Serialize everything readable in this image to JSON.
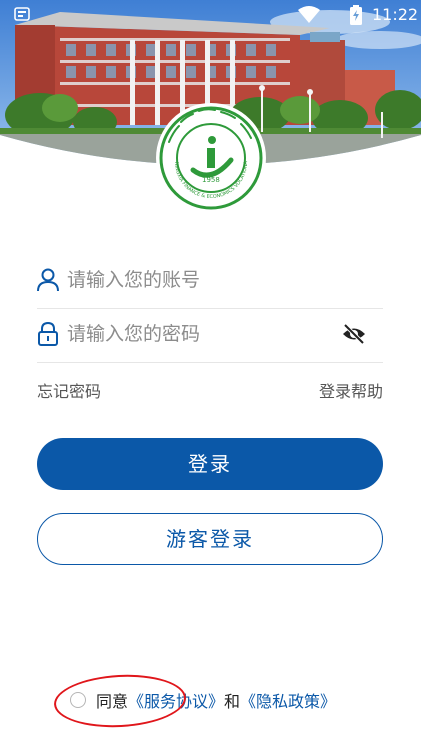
{
  "status_bar": {
    "time": "11:22",
    "icons": [
      "notification-icon",
      "wifi-icon",
      "battery-charging-icon"
    ]
  },
  "hero": {
    "image": "campus-building-photo"
  },
  "badge": {
    "year": "1958",
    "arc_text": "NINGXIA FINANCE & ECONOMICS VOCATIONAL COLLEGE",
    "calligraphy": "宁夏财经职业技术学院"
  },
  "login_form": {
    "account": {
      "placeholder": "请输入您的账号",
      "value": "",
      "icon": "user-icon"
    },
    "password": {
      "placeholder": "请输入您的密码",
      "value": "",
      "icon": "lock-icon",
      "toggle_icon": "eye-off-icon"
    },
    "forgot_password": "忘记密码",
    "login_help": "登录帮助",
    "login_button": "登录",
    "guest_login_button": "游客登录"
  },
  "agreement": {
    "checked": false,
    "prefix": "同意",
    "service_link": "《服务协议》",
    "conjunction": "和",
    "privacy_link": "《隐私政策》"
  },
  "colors": {
    "primary": "#0b58a8",
    "badge_green": "#2e9a3a",
    "annotation_red": "#e0161b"
  }
}
